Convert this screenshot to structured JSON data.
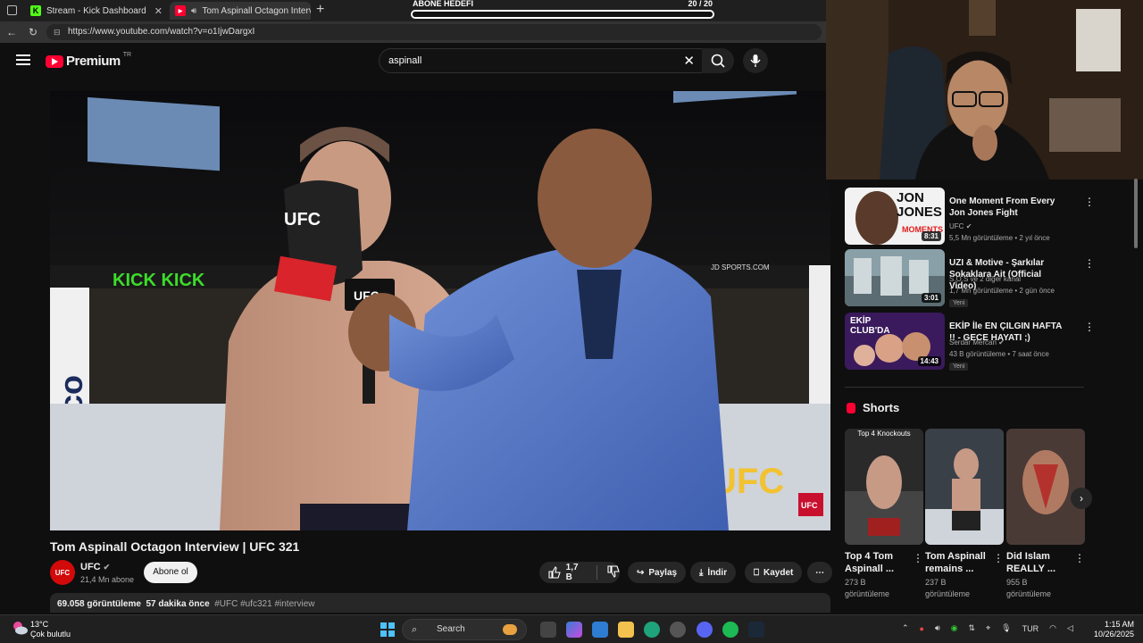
{
  "browser": {
    "tabs": [
      {
        "label": "Stream - Kick Dashboard",
        "favicon": "K"
      },
      {
        "label": "Tom Aspinall Octagon Interv",
        "favicon": "▶"
      }
    ],
    "url": "https://www.youtube.com/watch?v=o1IjwDargxI"
  },
  "overlay": {
    "goal_label": "ABONE HEDEFİ",
    "goal_count": "20 / 20",
    "goal_progress": 1.0
  },
  "youtube": {
    "logo_text": "Premium",
    "logo_region": "TR",
    "search_value": "aspinall"
  },
  "video": {
    "title": "Tom Aspinall Octagon Interview | UFC 321",
    "channel": {
      "name": "UFC",
      "subs": "21,4 Mn abone",
      "avatar_text": "UFC"
    },
    "subscribe_label": "Abone ol",
    "likes": "1,7 B",
    "share_label": "Paylaş",
    "download_label": "İndir",
    "save_label": "Kaydet",
    "views": "69.058 görüntüleme",
    "age": "57 dakika önce",
    "tags": "#UFC #ufc321 #interview"
  },
  "recommendations": [
    {
      "title": "One Moment From Every Jon Jones Fight",
      "channel": "UFC",
      "meta": "5,5 Mn görüntüleme • 2 yıl önce",
      "duration": "8:31",
      "badge": "",
      "thumb_text": "JON JONES",
      "thumb_sub": "MOMENTS"
    },
    {
      "title": "UZI & Motive - Şarkılar Sokaklara Ait (Official Video)",
      "channel": "S.O.S ve 2 diğer kanal",
      "meta": "1,7 Mn görüntüleme • 2 gün önce",
      "duration": "3:01",
      "badge": "Yeni",
      "thumb_text": "",
      "thumb_sub": ""
    },
    {
      "title": "EKİP İle EN ÇILGIN HAFTA !! - GECE HAYATI ;)",
      "channel": "Serdar Mercan",
      "meta": "43 B görüntüleme • 7 saat önce",
      "duration": "14:43",
      "badge": "Yeni",
      "thumb_text": "EKİP CLUB'DA",
      "thumb_sub": ""
    }
  ],
  "shorts": {
    "header": "Shorts",
    "items": [
      {
        "title": "Top 4 Tom Aspinall ...",
        "views": "273 B görüntüleme",
        "overlay": "Top 4 Knockouts"
      },
      {
        "title": "Tom Aspinall remains ...",
        "views": "237 B görüntüleme",
        "overlay": ""
      },
      {
        "title": "Did Islam REALLY ...",
        "views": "955 B görüntüleme",
        "overlay": ""
      }
    ]
  },
  "taskbar": {
    "temperature": "13°C",
    "weather": "Çok bulutlu",
    "search_label": "Search",
    "lang": "TUR",
    "time": "1:15 AM",
    "date": "10/26/2025"
  }
}
